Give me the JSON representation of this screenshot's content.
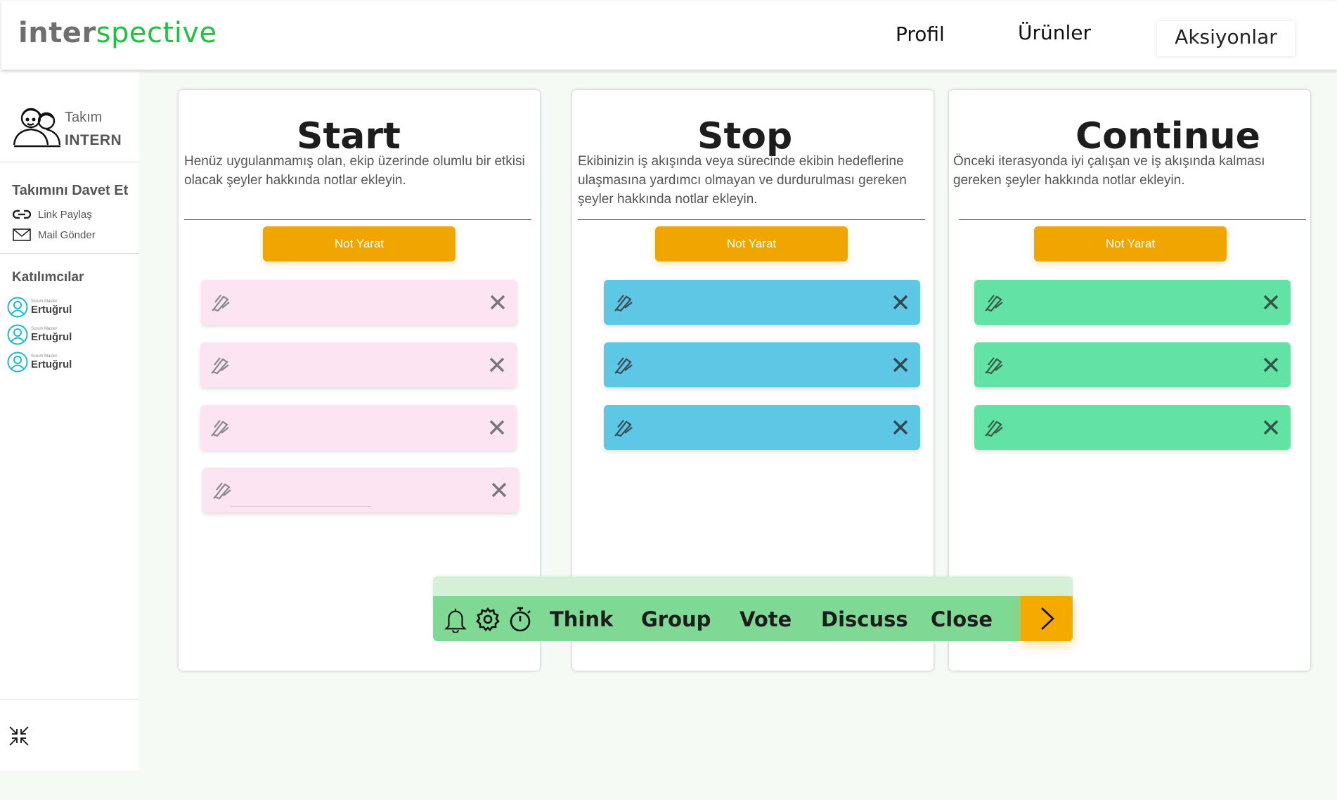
{
  "header": {
    "logo_part1": "inter",
    "logo_part2": "spective",
    "nav": {
      "profile": "Profil",
      "products": "Ürünler",
      "actions": "Aksiyonlar"
    }
  },
  "sidebar": {
    "team_label": "Takım",
    "team_name": "INTERN",
    "invite_title": "Takımını Davet Et",
    "share_link": "Link Paylaş",
    "send_mail": "Mail Gönder",
    "participants_title": "Katılımcılar",
    "participants": [
      {
        "role": "Scrum Master",
        "name": "Ertuğrul"
      },
      {
        "role": "Scrum Master",
        "name": "Ertuğrul"
      },
      {
        "role": "Scrum Master",
        "name": "Ertuğrul"
      }
    ]
  },
  "columns": [
    {
      "title": "Start",
      "description": "Henüz uygulanmamış olan, ekip üzerinde olumlu bir etkisi olacak şeyler hakkında notlar ekleyin.",
      "button": "Not Yarat",
      "note_color": "#fce4f3",
      "note_count": 4
    },
    {
      "title": "Stop",
      "description": "Ekibinizin iş akışında veya sürecinde ekibin hedeflerine ulaşmasına yardımcı olmayan ve durdurulması gereken şeyler hakkında notlar ekleyin.",
      "button": "Not Yarat",
      "note_color": "#5ec7e6",
      "note_count": 3
    },
    {
      "title": "Continue",
      "description": "Önceki iterasyonda iyi çalışan ve iş akışında kalması gereken şeyler hakkında notlar ekleyin.",
      "button": "Not Yarat",
      "note_color": "#62e2a4",
      "note_count": 3
    }
  ],
  "toolbar": {
    "phases": [
      "Think",
      "Group",
      "Vote",
      "Discuss",
      "Close"
    ],
    "icons": [
      "bell-icon",
      "gear-icon",
      "stopwatch-icon",
      "chevron-right-icon"
    ]
  },
  "colors": {
    "accent_orange": "#f0a500",
    "logo_green": "#22c045",
    "toolbar_green": "#7fd994"
  }
}
